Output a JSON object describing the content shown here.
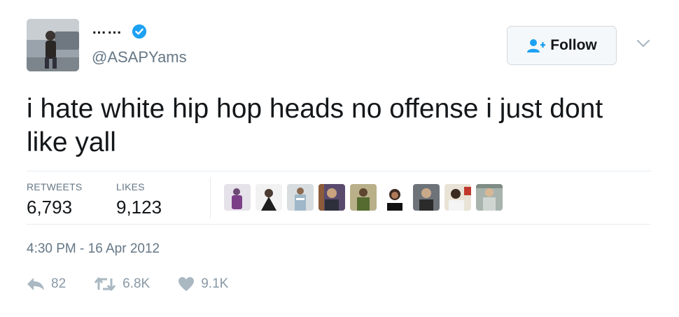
{
  "header": {
    "display_name": "……",
    "handle": "@ASAPYams",
    "follow_label": "Follow"
  },
  "tweet": {
    "text": "i hate white hip hop heads no offense i just dont like yall"
  },
  "stats": {
    "retweets_label": "RETWEETS",
    "retweets_value": "6,793",
    "likes_label": "LIKES",
    "likes_value": "9,123"
  },
  "timestamp": "4:30 PM - 16 Apr 2012",
  "actions": {
    "reply_count": "82",
    "retweet_count": "6.8K",
    "like_count": "9.1K"
  },
  "colors": {
    "verified_blue": "#1da1f2",
    "muted_text": "#657786",
    "action_gray": "#8899a6"
  }
}
